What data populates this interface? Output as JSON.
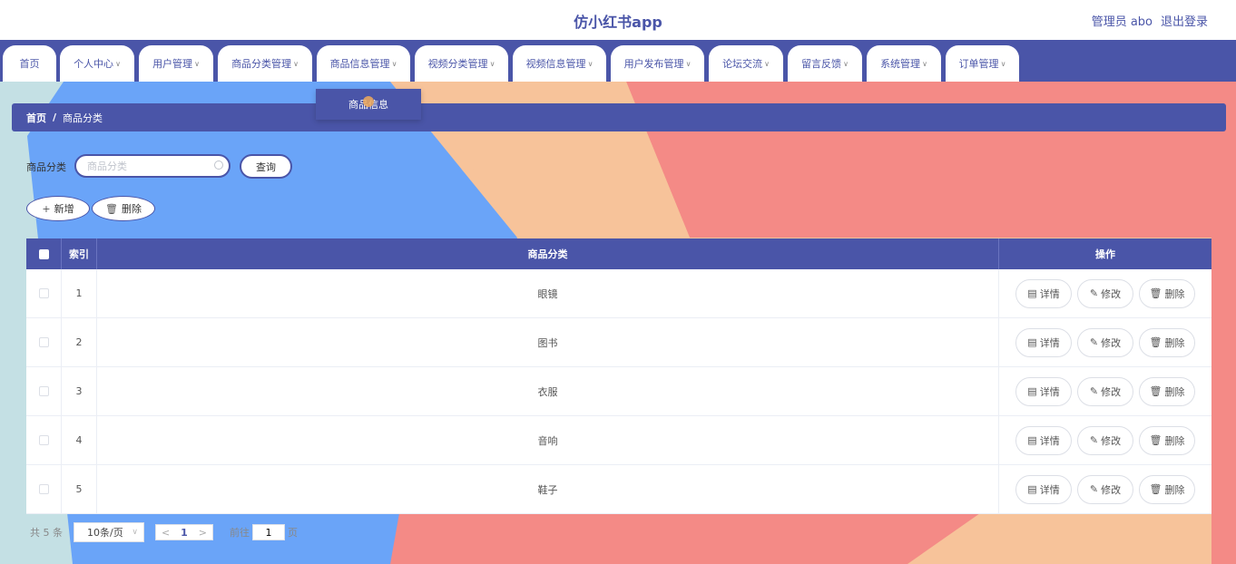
{
  "header": {
    "app_title": "仿小红书app",
    "admin_label": "管理员 abo",
    "logout_label": "退出登录"
  },
  "nav": {
    "items": [
      {
        "label": "首页",
        "has_dropdown": false
      },
      {
        "label": "个人中心",
        "has_dropdown": true
      },
      {
        "label": "用户管理",
        "has_dropdown": true
      },
      {
        "label": "商品分类管理",
        "has_dropdown": true
      },
      {
        "label": "商品信息管理",
        "has_dropdown": true
      },
      {
        "label": "视频分类管理",
        "has_dropdown": true
      },
      {
        "label": "视频信息管理",
        "has_dropdown": true
      },
      {
        "label": "用户发布管理",
        "has_dropdown": true
      },
      {
        "label": "论坛交流",
        "has_dropdown": true
      },
      {
        "label": "留言反馈",
        "has_dropdown": true
      },
      {
        "label": "系统管理",
        "has_dropdown": true
      },
      {
        "label": "订单管理",
        "has_dropdown": true
      }
    ],
    "open_dropdown": {
      "label": "商品信息"
    }
  },
  "breadcrumb": {
    "home": "首页",
    "separator": "/",
    "current": "商品分类"
  },
  "search": {
    "label": "商品分类",
    "placeholder": "商品分类",
    "value": "",
    "button_label": "查询"
  },
  "toolbar": {
    "add_label": "新增",
    "delete_label": "删除"
  },
  "table": {
    "headers": {
      "index": "索引",
      "category": "商品分类",
      "actions": "操作"
    },
    "rows": [
      {
        "index": "1",
        "category": "眼镜"
      },
      {
        "index": "2",
        "category": "图书"
      },
      {
        "index": "3",
        "category": "衣服"
      },
      {
        "index": "4",
        "category": "音响"
      },
      {
        "index": "5",
        "category": "鞋子"
      }
    ],
    "row_actions": {
      "detail": "详情",
      "edit": "修改",
      "delete": "删除"
    }
  },
  "pagination": {
    "total_text": "共 5 条",
    "page_size": "10条/页",
    "current_page": "1",
    "goto_label": "前往",
    "goto_value": "1",
    "page_suffix": "页"
  },
  "colors": {
    "primary": "#4a55a8",
    "bg_blue": "#6aa4f8",
    "bg_peach": "#f7c39a",
    "bg_coral": "#f48a86",
    "bg_teal": "#c4e0e4"
  }
}
